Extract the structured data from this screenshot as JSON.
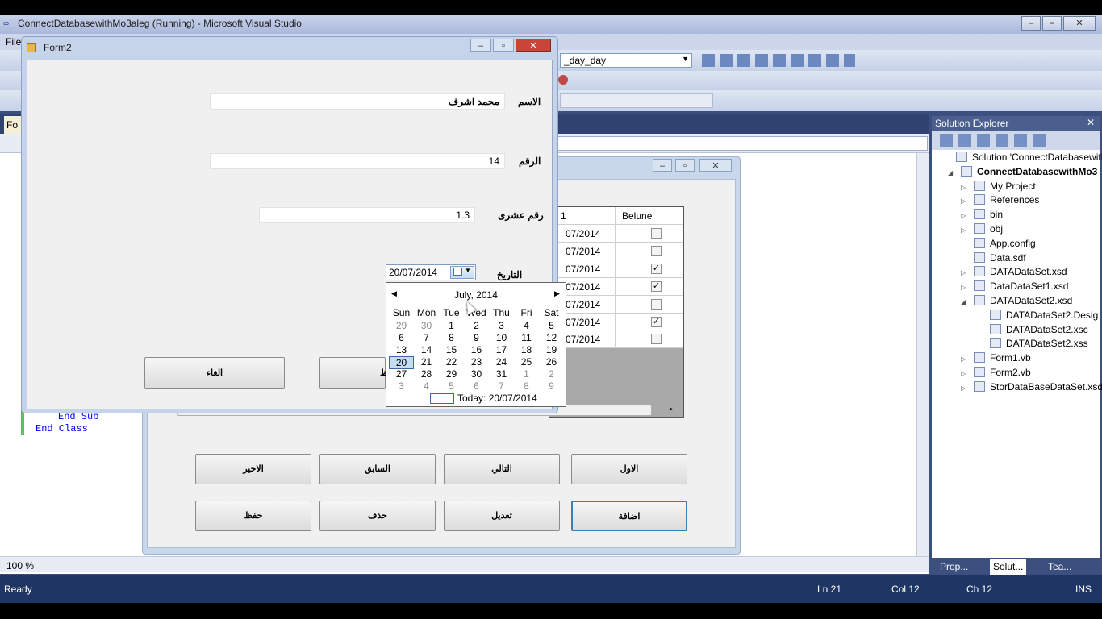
{
  "vs": {
    "title": "ConnectDatabasewithMo3aleg (Running) - Microsoft Visual Studio",
    "menu_first": "File",
    "config_combo": "_day_day",
    "doc_tab": "Fo",
    "code_lines": [
      "End Sub",
      "End Class"
    ],
    "zoom": "100 %",
    "status": {
      "ready": "Ready",
      "ln": "Ln 21",
      "col": "Col 12",
      "ch": "Ch 12",
      "ins": "INS"
    }
  },
  "solution_explorer": {
    "title": "Solution Explorer",
    "nodes": [
      {
        "label": "Solution 'ConnectDatabasewith",
        "bold": false
      },
      {
        "label": "ConnectDatabasewithMo3",
        "bold": true
      },
      {
        "label": "My Project"
      },
      {
        "label": "References"
      },
      {
        "label": "bin"
      },
      {
        "label": "obj"
      },
      {
        "label": "App.config"
      },
      {
        "label": "Data.sdf"
      },
      {
        "label": "DATADataSet.xsd"
      },
      {
        "label": "DataDataSet1.xsd"
      },
      {
        "label": "DATADataSet2.xsd"
      },
      {
        "label": "DATADataSet2.Desig"
      },
      {
        "label": "DATADataSet2.xsc"
      },
      {
        "label": "DATADataSet2.xss"
      },
      {
        "label": "Form1.vb"
      },
      {
        "label": "Form2.vb"
      },
      {
        "label": "StorDataBaseDataSet.xsd"
      }
    ],
    "tabs": [
      "Prop...",
      "Solut...",
      "Tea..."
    ]
  },
  "form1": {
    "grid": {
      "col1_header": "1",
      "col2_header": "Belune",
      "rows": [
        {
          "date": "07/2014",
          "checked": false
        },
        {
          "date": "07/2014",
          "checked": false
        },
        {
          "date": "07/2014",
          "checked": true
        },
        {
          "date": "07/2014",
          "checked": true
        },
        {
          "date": "07/2014",
          "checked": false
        },
        {
          "date": "07/2014",
          "checked": true
        },
        {
          "date": "07/2014",
          "checked": false
        }
      ]
    },
    "buttons_row1": [
      "الاخير",
      "السابق",
      "التالي",
      "الاول"
    ],
    "buttons_row2": [
      "حفظ",
      "حذف",
      "تعديل",
      "اضافة"
    ]
  },
  "form2": {
    "title": "Form2",
    "name_label": "الاسم",
    "name_value": "محمد اشرف",
    "number_label": "الرقم",
    "number_value": "14",
    "decimal_label": "رقم عشرى",
    "decimal_value": "1.3",
    "date_label": "التاريخ",
    "date_value": "20/07/2014",
    "cancel_button": "الغاء",
    "save_button_partial": "ظ"
  },
  "calendar": {
    "month": "July, 2014",
    "days_of_week": [
      "Sun",
      "Mon",
      "Tue",
      "Wed",
      "Thu",
      "Fri",
      "Sat"
    ],
    "weeks": [
      [
        "29",
        "30",
        "1",
        "2",
        "3",
        "4",
        "5"
      ],
      [
        "6",
        "7",
        "8",
        "9",
        "10",
        "11",
        "12"
      ],
      [
        "13",
        "14",
        "15",
        "16",
        "17",
        "18",
        "19"
      ],
      [
        "20",
        "21",
        "22",
        "23",
        "24",
        "25",
        "26"
      ],
      [
        "27",
        "28",
        "29",
        "30",
        "31",
        "1",
        "2"
      ],
      [
        "3",
        "4",
        "5",
        "6",
        "7",
        "8",
        "9"
      ]
    ],
    "selected": "20",
    "today_text": "Today: 20/07/2014"
  }
}
